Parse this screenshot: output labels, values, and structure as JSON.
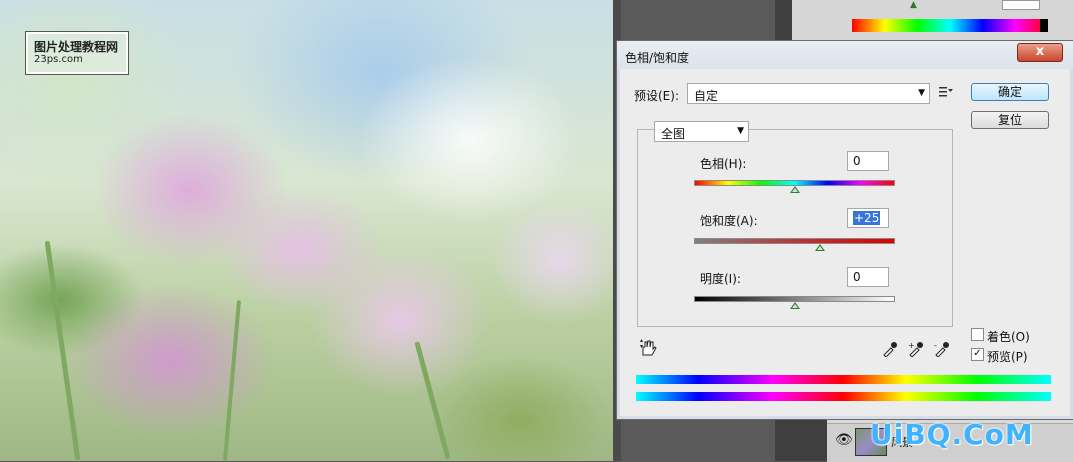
{
  "photo": {
    "watermark_line1": "图片处理教程网",
    "watermark_line2": "23ps.com"
  },
  "site_watermark": "UiBQ.CoM",
  "layers_panel": {
    "layer_name": "风景"
  },
  "dialog": {
    "title": "色相/饱和度",
    "close_label": "x",
    "preset_label": "预设(E):",
    "preset_value": "自定",
    "channel_value": "全图",
    "ok_label": "确定",
    "reset_label": "复位",
    "hue": {
      "label": "色相(H):",
      "value": "0"
    },
    "saturation": {
      "label": "饱和度(A):",
      "value": "+25"
    },
    "lightness": {
      "label": "明度(I):",
      "value": "0"
    },
    "colorize_label": "着色(O)",
    "colorize_checked": false,
    "preview_label": "预览(P)",
    "preview_checked": true,
    "preview_check_mark": "✓"
  },
  "icons": [
    "preset-menu-icon",
    "hand-target-icon",
    "eyedropper-icon",
    "eyedropper-plus-icon",
    "eyedropper-minus-icon",
    "eye-icon"
  ]
}
